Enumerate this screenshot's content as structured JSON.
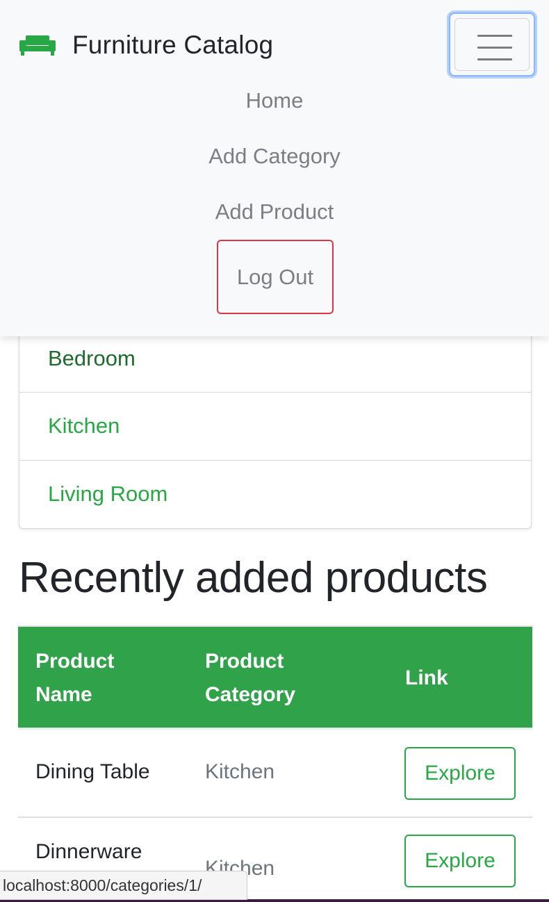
{
  "navbar": {
    "brand": "Furniture Catalog",
    "brand_icon": "sofa-icon",
    "brand_color": "#28a745",
    "toggler_icon": "hamburger-icon",
    "links": [
      "Home",
      "Add Category",
      "Add Product"
    ],
    "logout_label": "Log Out",
    "logout_border_color": "#dc3545"
  },
  "categories": [
    "Bedroom",
    "Kitchen",
    "Living Room"
  ],
  "section_title": "Recently added products",
  "table": {
    "headers": {
      "name_line1": "Product",
      "name_line2": "Name",
      "category_line1": "Product",
      "category_line2": "Category",
      "link": "Link"
    },
    "header_color": "#30a24a",
    "rows": [
      {
        "name": "Dining Table",
        "category": "Kitchen",
        "button": "Explore"
      },
      {
        "name": "Dinnerware",
        "category": "Kitchen",
        "button": "Explore"
      }
    ]
  },
  "status_url": "localhost:8000/categories/1/"
}
